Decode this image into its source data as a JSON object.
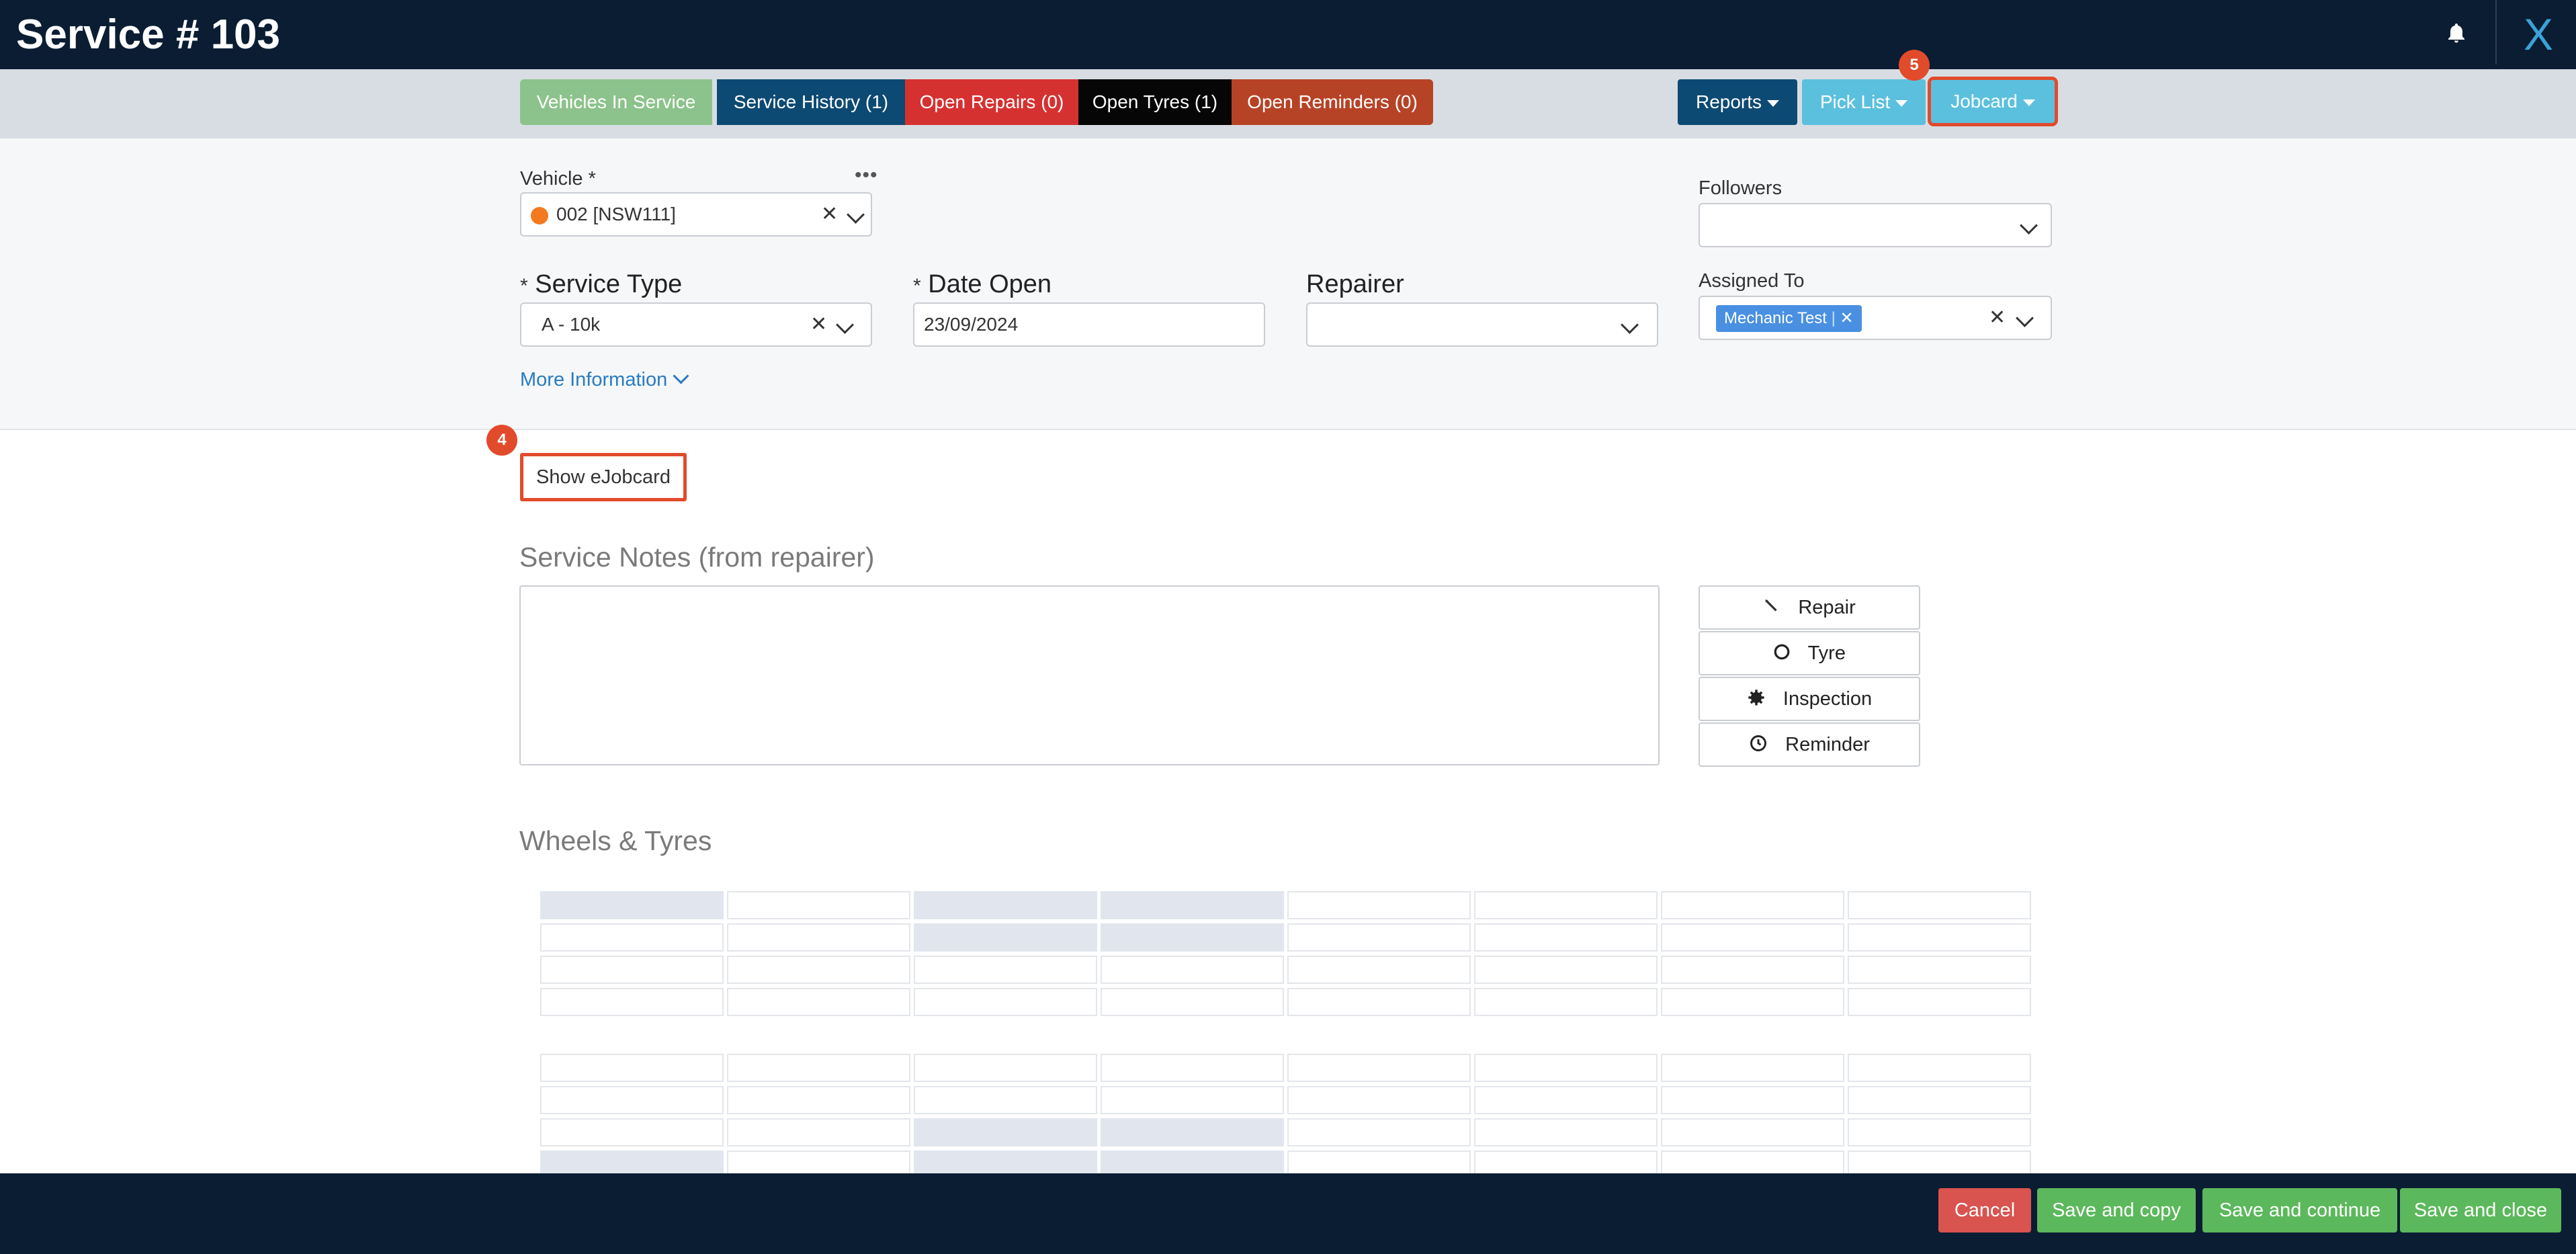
{
  "header": {
    "title": "Service # 103",
    "close_label": "X"
  },
  "toolbar": {
    "tabs": [
      {
        "label": "Vehicles In Service",
        "color": "#8cc38c"
      },
      {
        "label": "Service History (1)",
        "color": "#0d4a73"
      },
      {
        "label": "Open Repairs (0)",
        "color": "#d63131"
      },
      {
        "label": "Open Tyres (1)",
        "color": "#060606"
      },
      {
        "label": "Open Reminders (0)",
        "color": "#b74326"
      }
    ],
    "reports_label": "Reports",
    "picklist_label": "Pick List",
    "jobcard_label": "Jobcard",
    "jobcard_badge": "5"
  },
  "form": {
    "vehicle_label": "Vehicle",
    "vehicle_required": "*",
    "vehicle_value": "002 [NSW111]",
    "followers_label": "Followers",
    "service_type_label": "Service Type",
    "service_type_value": "A - 10k",
    "date_open_label": "Date Open",
    "date_open_value": "23/09/2024",
    "repairer_label": "Repairer",
    "assigned_to_label": "Assigned To",
    "assigned_to_tag": "Mechanic Test",
    "required_mark": "*",
    "more_info_label": "More Information"
  },
  "ejobcard": {
    "label": "Show eJobcard",
    "badge": "4"
  },
  "notes": {
    "title": "Service Notes (from repairer)"
  },
  "side_buttons": [
    {
      "label": "Repair",
      "icon": "wrench-icon"
    },
    {
      "label": "Tyre",
      "icon": "circle-icon"
    },
    {
      "label": "Inspection",
      "icon": "gear-icon"
    },
    {
      "label": "Reminder",
      "icon": "clock-icon"
    }
  ],
  "wheels": {
    "title": "Wheels & Tyres"
  },
  "footer": {
    "cancel_label": "Cancel",
    "save_copy_label": "Save and copy",
    "save_continue_label": "Save and continue",
    "save_close_label": "Save and close"
  }
}
